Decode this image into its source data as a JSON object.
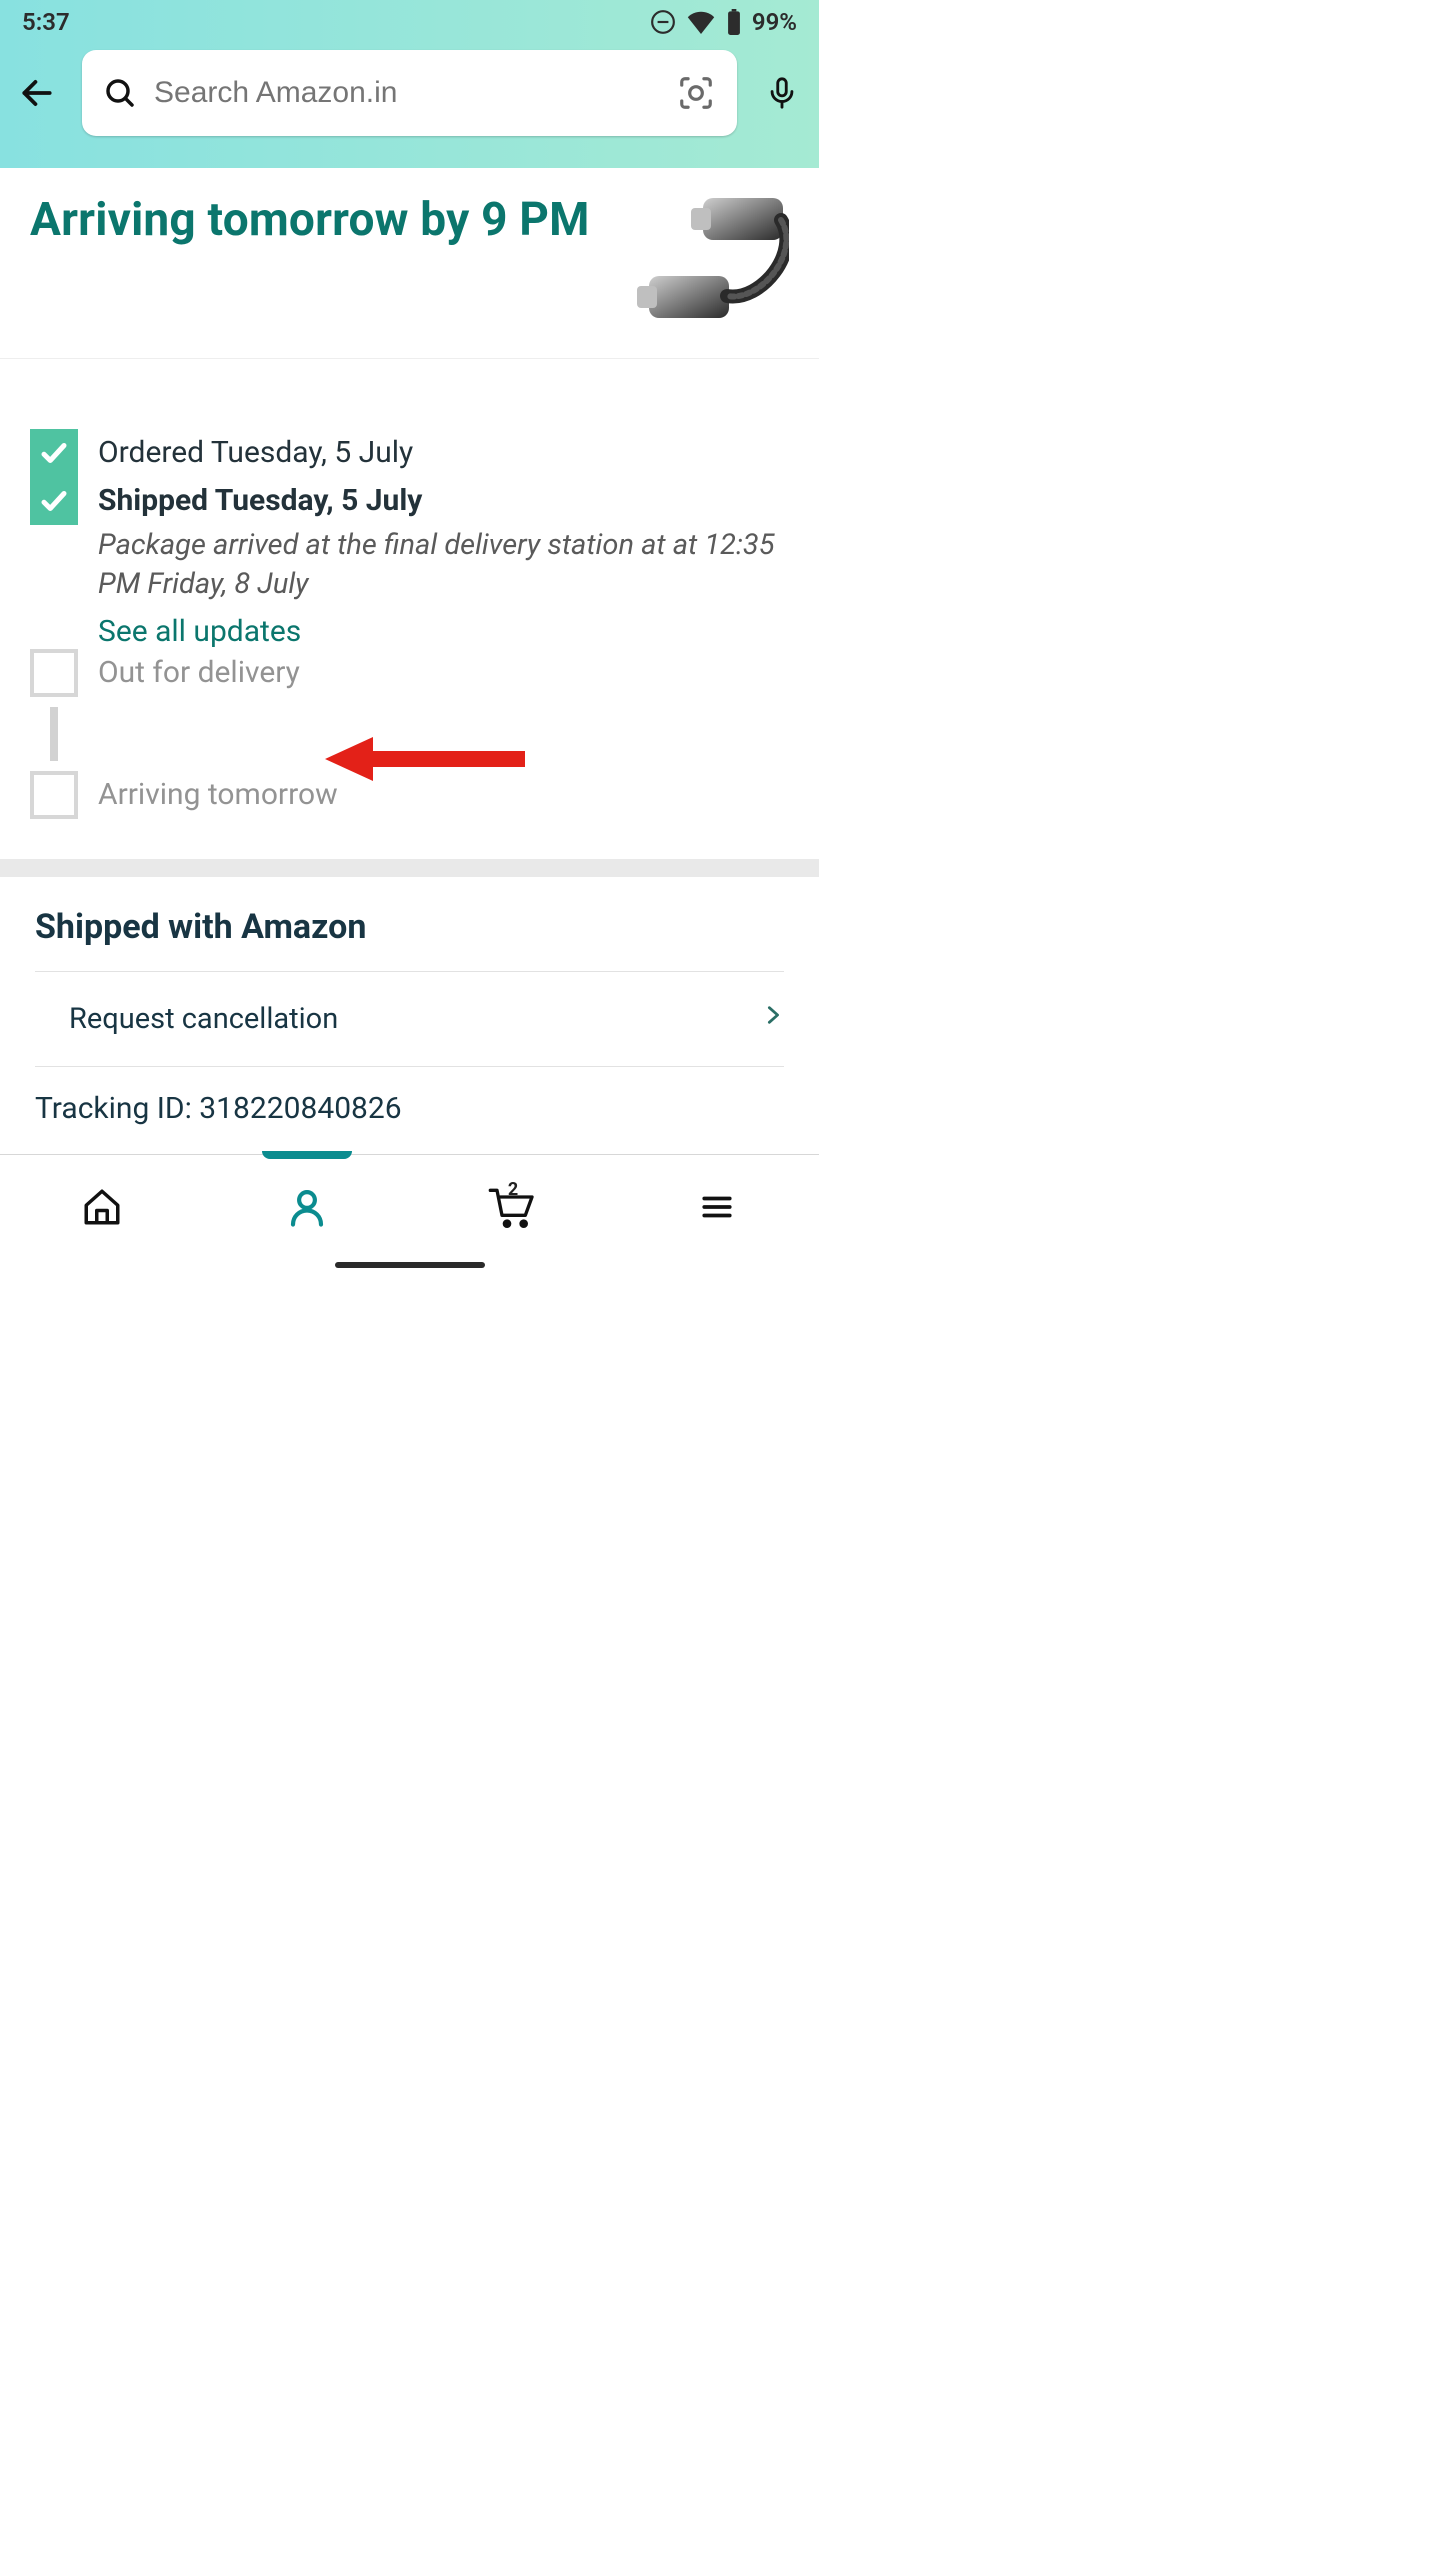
{
  "status_bar": {
    "time": "5:37",
    "battery_pct": "99%"
  },
  "search": {
    "placeholder": "Search Amazon.in"
  },
  "headline": "Arriving tomorrow by 9 PM",
  "timeline": {
    "ordered": {
      "title": "Ordered Tuesday, 5 July"
    },
    "shipped": {
      "title": "Shipped Tuesday, 5 July",
      "detail": "Package arrived at the final delivery station at at 12:35 PM Friday, 8 July",
      "see_all": "See all updates"
    },
    "out": {
      "title": "Out for delivery"
    },
    "arriving": {
      "title": "Arriving tomorrow"
    }
  },
  "shipping": {
    "carrier_heading": "Shipped with Amazon",
    "request_cancel": "Request cancellation",
    "tracking_label": "Tracking ID: 318220840826"
  },
  "nav": {
    "cart_count": "2"
  }
}
